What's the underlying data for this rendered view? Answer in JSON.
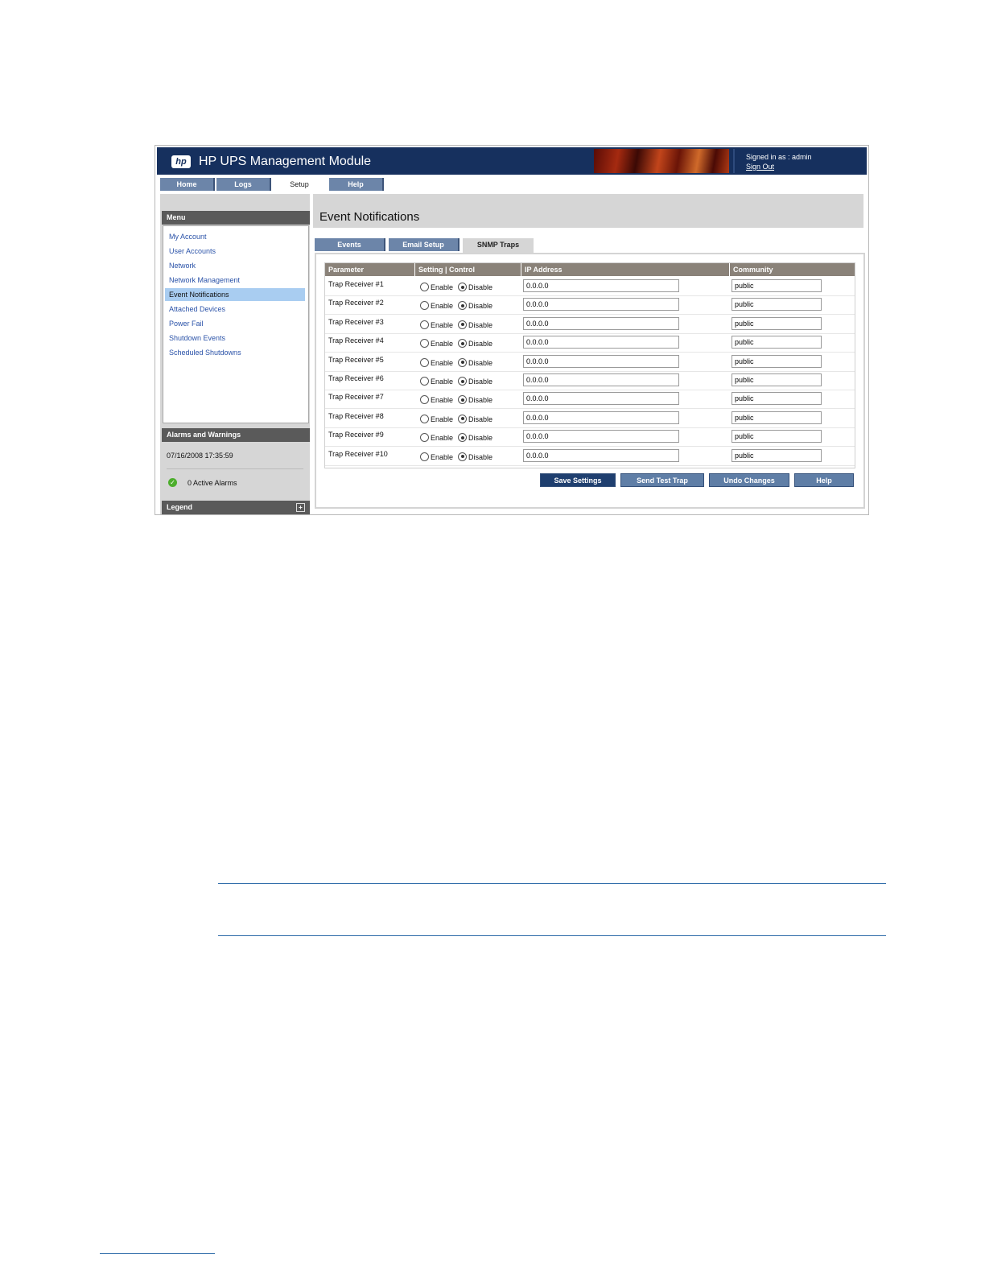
{
  "header": {
    "title": "HP UPS Management Module",
    "logo_text": "hp",
    "signed_in": "Signed in as : admin",
    "sign_out": "Sign Out"
  },
  "top_tabs": [
    {
      "label": "Home",
      "active": false
    },
    {
      "label": "Logs",
      "active": false
    },
    {
      "label": "Setup",
      "active": true
    },
    {
      "label": "Help",
      "active": false
    }
  ],
  "sidebar": {
    "menu_header": "Menu",
    "items": [
      {
        "label": "My Account",
        "active": false
      },
      {
        "label": "User Accounts",
        "active": false
      },
      {
        "label": "Network",
        "active": false
      },
      {
        "label": "Network Management",
        "active": false
      },
      {
        "label": "Event Notifications",
        "active": true
      },
      {
        "label": "Attached Devices",
        "active": false
      },
      {
        "label": "Power Fail",
        "active": false
      },
      {
        "label": "Shutdown Events",
        "active": false
      },
      {
        "label": "Scheduled Shutdowns",
        "active": false
      }
    ],
    "alarms_header": "Alarms and Warnings",
    "alarm_timestamp": "07/16/2008 17:35:59",
    "active_alarms": "0 Active Alarms",
    "legend_header": "Legend"
  },
  "main": {
    "page_title": "Event Notifications",
    "sub_tabs": [
      {
        "label": "Events",
        "active": false
      },
      {
        "label": "Email Setup",
        "active": false
      },
      {
        "label": "SNMP Traps",
        "active": true
      }
    ],
    "columns": [
      "Parameter",
      "Setting | Control",
      "IP Address",
      "Community"
    ],
    "enable_label": "Enable",
    "disable_label": "Disable",
    "rows": [
      {
        "label": "Trap Receiver #1",
        "enabled": false,
        "ip": "0.0.0.0",
        "community": "public"
      },
      {
        "label": "Trap Receiver #2",
        "enabled": false,
        "ip": "0.0.0.0",
        "community": "public"
      },
      {
        "label": "Trap Receiver #3",
        "enabled": false,
        "ip": "0.0.0.0",
        "community": "public"
      },
      {
        "label": "Trap Receiver #4",
        "enabled": false,
        "ip": "0.0.0.0",
        "community": "public"
      },
      {
        "label": "Trap Receiver #5",
        "enabled": false,
        "ip": "0.0.0.0",
        "community": "public"
      },
      {
        "label": "Trap Receiver #6",
        "enabled": false,
        "ip": "0.0.0.0",
        "community": "public"
      },
      {
        "label": "Trap Receiver #7",
        "enabled": false,
        "ip": "0.0.0.0",
        "community": "public"
      },
      {
        "label": "Trap Receiver #8",
        "enabled": false,
        "ip": "0.0.0.0",
        "community": "public"
      },
      {
        "label": "Trap Receiver #9",
        "enabled": false,
        "ip": "0.0.0.0",
        "community": "public"
      },
      {
        "label": "Trap Receiver #10",
        "enabled": false,
        "ip": "0.0.0.0",
        "community": "public"
      }
    ],
    "buttons": [
      "Save Settings",
      "Send Test Trap",
      "Undo Changes",
      "Help"
    ]
  },
  "colors": {
    "header_bg": "#16305e",
    "tab_bg": "#6c85a9",
    "selected_menu_bg": "#a9cdf1",
    "grid_header_bg": "#8a8279",
    "success_icon": "#4cae2c",
    "rule_line": "#2c6aa8"
  },
  "icons": {
    "logo": "hp-logo-icon",
    "status": "check-circle-icon",
    "legend": "expand-plus-icon"
  }
}
